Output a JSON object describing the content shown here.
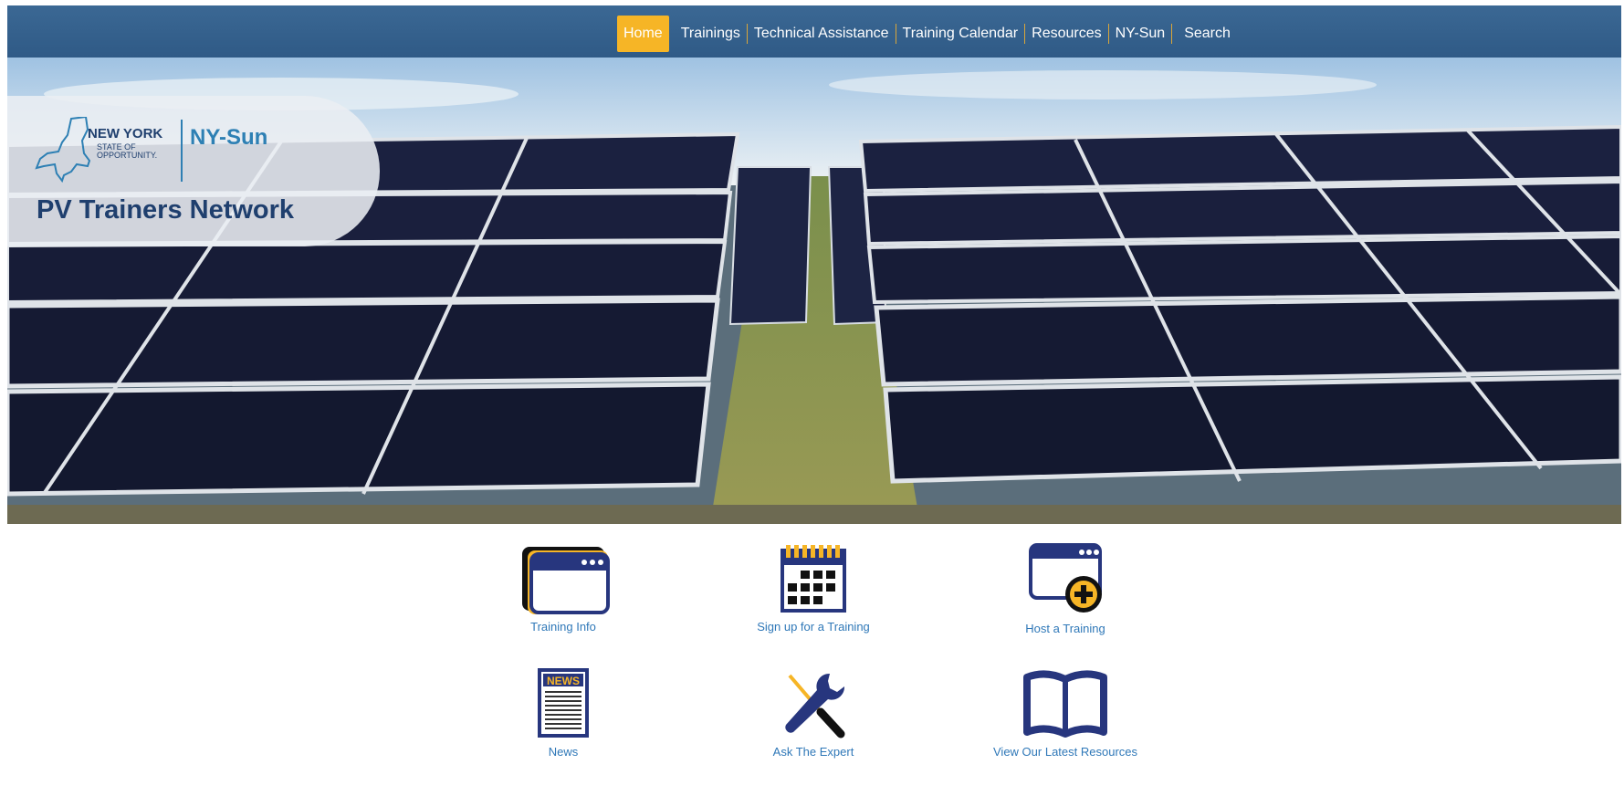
{
  "nav": {
    "items": [
      {
        "label": "Home",
        "active": true
      },
      {
        "label": "Trainings"
      },
      {
        "label": "Technical Assistance"
      },
      {
        "label": "Training Calendar"
      },
      {
        "label": "Resources"
      },
      {
        "label": "NY-Sun"
      },
      {
        "label": "Search"
      }
    ]
  },
  "hero": {
    "logo": {
      "state_name": "NEW YORK",
      "state_tagline_line1": "STATE OF",
      "state_tagline_line2": "OPPORTUNITY.",
      "program": "NY-Sun"
    },
    "title": "PV Trainers Network"
  },
  "tiles": [
    {
      "label": "Training Info",
      "icon": "browser-window-icon"
    },
    {
      "label": "Sign up for a Training",
      "icon": "calendar-icon"
    },
    {
      "label": "Host a Training",
      "icon": "browser-add-icon"
    },
    {
      "label": "News",
      "icon": "newspaper-icon"
    },
    {
      "label": "Ask The Expert",
      "icon": "wrench-screwdriver-icon"
    },
    {
      "label": "View Our Latest Resources",
      "icon": "open-book-icon"
    }
  ],
  "colors": {
    "nav_bg": "#2f5a86",
    "nav_active": "#f6b526",
    "brand_navy": "#1f3f6e",
    "brand_blue": "#2e80b4",
    "icon_navy": "#27367e",
    "icon_gold": "#f6b526",
    "link": "#2f78b8"
  }
}
